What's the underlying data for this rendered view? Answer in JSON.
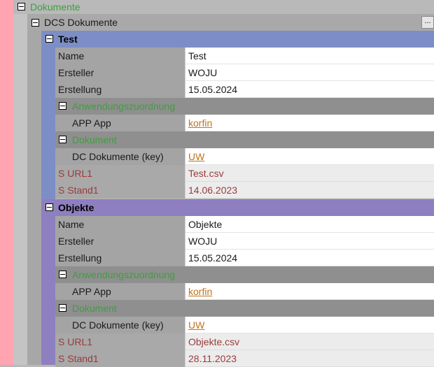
{
  "colors": {
    "left_strip": "#ffa4b0",
    "section_test": "#7d8ec6",
    "section_objekte": "#8e7fc0",
    "green_text": "#3f9e3f",
    "link": "#c0731a",
    "red_text": "#9a3b3b"
  },
  "tree": {
    "root_label": "Dokumente",
    "dcs_label": "DCS Dokumente",
    "ellipsis": "..."
  },
  "test": {
    "title": "Test",
    "name_key": "Name",
    "name_val": "Test",
    "ersteller_key": "Ersteller",
    "ersteller_val": "WOJU",
    "erstellung_key": "Erstellung",
    "erstellung_val": "15.05.2024",
    "anw_label": "Anwendungszuordnung",
    "app_key": "APP App",
    "app_val": "korfin",
    "dok_label": "Dokument",
    "dc_key": "DC Dokumente (key)",
    "dc_val": "UW",
    "url_key": "S URL1",
    "url_val": "Test.csv",
    "stand_key": "S Stand1",
    "stand_val": "14.06.2023"
  },
  "objekte": {
    "title": "Objekte",
    "name_key": "Name",
    "name_val": "Objekte",
    "ersteller_key": "Ersteller",
    "ersteller_val": "WOJU",
    "erstellung_key": "Erstellung",
    "erstellung_val": "15.05.2024",
    "anw_label": "Anwendungszuordnung",
    "app_key": "APP App",
    "app_val": "korfin",
    "dok_label": "Dokument",
    "dc_key": "DC Dokumente (key)",
    "dc_val": "UW",
    "url_key": "S URL1",
    "url_val": "Objekte.csv",
    "stand_key": "S Stand1",
    "stand_val": "28.11.2023"
  }
}
